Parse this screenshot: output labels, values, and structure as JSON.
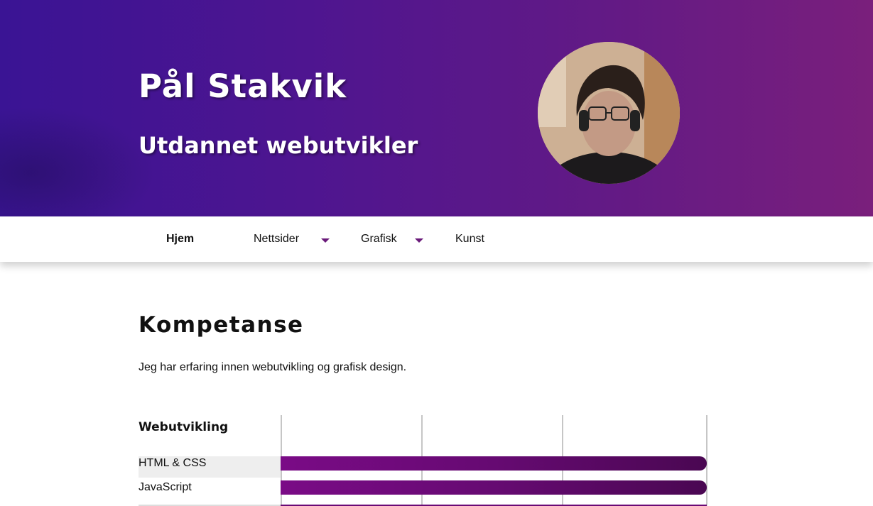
{
  "hero": {
    "name": "Pål Stakvik",
    "title": "Utdannet webutvikler"
  },
  "nav": {
    "items": [
      {
        "label": "Hjem",
        "active": true,
        "dropdown": false
      },
      {
        "label": "Nettsider",
        "active": false,
        "dropdown": true
      },
      {
        "label": "Grafisk",
        "active": false,
        "dropdown": true
      },
      {
        "label": "Kunst",
        "active": false,
        "dropdown": false
      }
    ]
  },
  "competence": {
    "heading": "Kompetanse",
    "intro": "Jeg har erfaring innen webutvikling og grafisk design.",
    "category": "Webutvikling",
    "skills": [
      {
        "label": "HTML & CSS",
        "level": 1.0
      },
      {
        "label": "JavaScript",
        "level": 1.0
      }
    ]
  },
  "colors": {
    "hero_start": "#3a1494",
    "hero_end": "#7a1f7c",
    "bar": "#6a0a75",
    "caret": "#6a1a7a"
  }
}
